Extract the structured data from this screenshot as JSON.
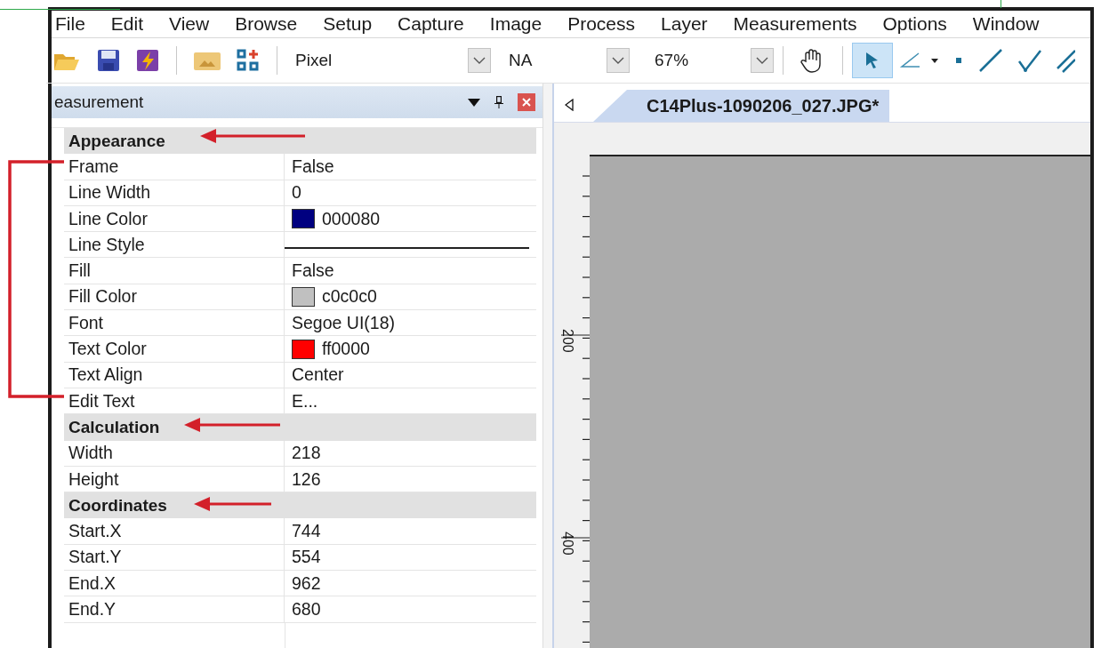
{
  "menu": [
    "File",
    "Edit",
    "View",
    "Browse",
    "Setup",
    "Capture",
    "Image",
    "Process",
    "Layer",
    "Measurements",
    "Options",
    "Window"
  ],
  "toolbar": {
    "combos": [
      {
        "value": "Pixel"
      },
      {
        "value": "NA"
      },
      {
        "value": "67%"
      }
    ],
    "tools": [
      {
        "kind": "hand",
        "selected": false
      },
      {
        "kind": "pointer",
        "selected": true
      },
      {
        "kind": "angle",
        "selected": false
      },
      {
        "kind": "point",
        "selected": false
      },
      {
        "kind": "line",
        "selected": false
      },
      {
        "kind": "polyline",
        "selected": false
      },
      {
        "kind": "parallel",
        "selected": false
      }
    ]
  },
  "panel": {
    "title": "easurement",
    "categories": [
      {
        "name": "Appearance",
        "properties": [
          {
            "name": "Frame",
            "kind": "text",
            "value": "False"
          },
          {
            "name": "Line Width",
            "kind": "text",
            "value": "0"
          },
          {
            "name": "Line Color",
            "kind": "color",
            "value": "000080",
            "color": "#000080"
          },
          {
            "name": "Line Style",
            "kind": "line"
          },
          {
            "name": "Fill",
            "kind": "text",
            "value": "False"
          },
          {
            "name": "Fill Color",
            "kind": "color",
            "value": "c0c0c0",
            "color": "#c0c0c0"
          },
          {
            "name": "Font",
            "kind": "text",
            "value": "Segoe UI(18)"
          },
          {
            "name": "Text Color",
            "kind": "color",
            "value": "ff0000",
            "color": "#ff0000"
          },
          {
            "name": "Text Align",
            "kind": "text",
            "value": "Center"
          },
          {
            "name": "Edit Text",
            "kind": "text",
            "value": "E..."
          }
        ]
      },
      {
        "name": "Calculation",
        "properties": [
          {
            "name": "Width",
            "kind": "text",
            "value": "218"
          },
          {
            "name": "Height",
            "kind": "text",
            "value": "126"
          }
        ]
      },
      {
        "name": "Coordinates",
        "properties": [
          {
            "name": "Start.X",
            "kind": "text",
            "value": "744"
          },
          {
            "name": "Start.Y",
            "kind": "text",
            "value": "554"
          },
          {
            "name": "End.X",
            "kind": "text",
            "value": "962"
          },
          {
            "name": "End.Y",
            "kind": "text",
            "value": "680"
          }
        ]
      }
    ]
  },
  "document_tab": {
    "title": "C14Plus-1090206_027.JPG*",
    "selected": true
  },
  "ruler": {
    "labels": [
      "200",
      "400"
    ]
  }
}
